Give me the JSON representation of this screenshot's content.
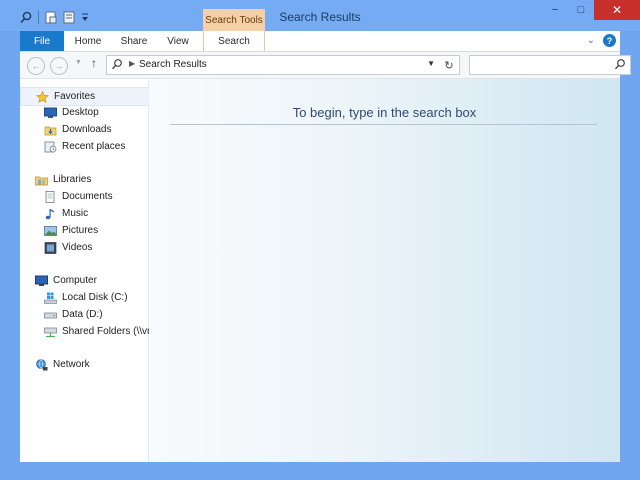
{
  "window": {
    "title": "Search Results",
    "context_tab_header": "Search Tools",
    "caption_buttons": {
      "minimize": "−",
      "maximize": "□",
      "close": "✕"
    }
  },
  "ribbon": {
    "tabs": [
      {
        "label": "File"
      },
      {
        "label": "Home"
      },
      {
        "label": "Share"
      },
      {
        "label": "View"
      },
      {
        "label": "Search"
      }
    ],
    "help_label": "?"
  },
  "address": {
    "breadcrumb": "Search Results",
    "search_value": "",
    "search_placeholder": ""
  },
  "navigation": {
    "favorites": {
      "label": "Favorites",
      "items": [
        "Desktop",
        "Downloads",
        "Recent places"
      ]
    },
    "libraries": {
      "label": "Libraries",
      "items": [
        "Documents",
        "Music",
        "Pictures",
        "Videos"
      ]
    },
    "computer": {
      "label": "Computer",
      "items": [
        "Local Disk (C:)",
        "Data (D:)",
        "Shared Folders (\\\\vm"
      ]
    },
    "network": {
      "label": "Network"
    }
  },
  "content": {
    "prompt": "To begin, type in the search box"
  },
  "colors": {
    "accent": "#1979ca",
    "titlebar": "#74abf2",
    "close": "#c7302b",
    "context_tab": "#f5cfa6"
  }
}
